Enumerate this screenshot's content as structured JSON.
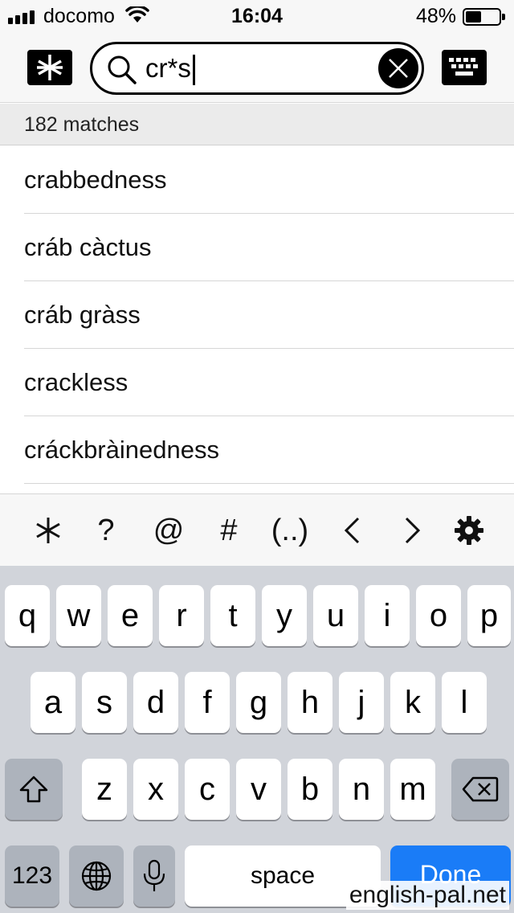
{
  "status": {
    "carrier": "docomo",
    "time": "16:04",
    "battery_percent": "48%",
    "battery_level": 0.48
  },
  "search": {
    "query": "cr*s",
    "placeholder": ""
  },
  "toolbar": {
    "wildcard_icon": "asterisk-icon",
    "keyboard_icon": "keyboard-icon"
  },
  "results": {
    "count_text": "182 matches",
    "items": [
      {
        "word": "crabbedness"
      },
      {
        "word": "cráb càctus"
      },
      {
        "word": "cráb gràss"
      },
      {
        "word": "crackless"
      },
      {
        "word": "cráckbràinedness"
      }
    ]
  },
  "symbols": {
    "asterisk": "∗",
    "question": "?",
    "at": "@",
    "hash": "#",
    "group": "(..)",
    "prev": "<",
    "next": ">",
    "settings_icon": "gear-icon"
  },
  "keyboard": {
    "row1": [
      "q",
      "w",
      "e",
      "r",
      "t",
      "y",
      "u",
      "i",
      "o",
      "p"
    ],
    "row2": [
      "a",
      "s",
      "d",
      "f",
      "g",
      "h",
      "j",
      "k",
      "l"
    ],
    "row3": [
      "z",
      "x",
      "c",
      "v",
      "b",
      "n",
      "m"
    ],
    "numbers_label": "123",
    "space_label": "space",
    "done_label": "Done"
  },
  "watermark": "english-pal.net",
  "colors": {
    "accent": "#1a7cf7",
    "keyboard_bg": "#d1d4da"
  }
}
